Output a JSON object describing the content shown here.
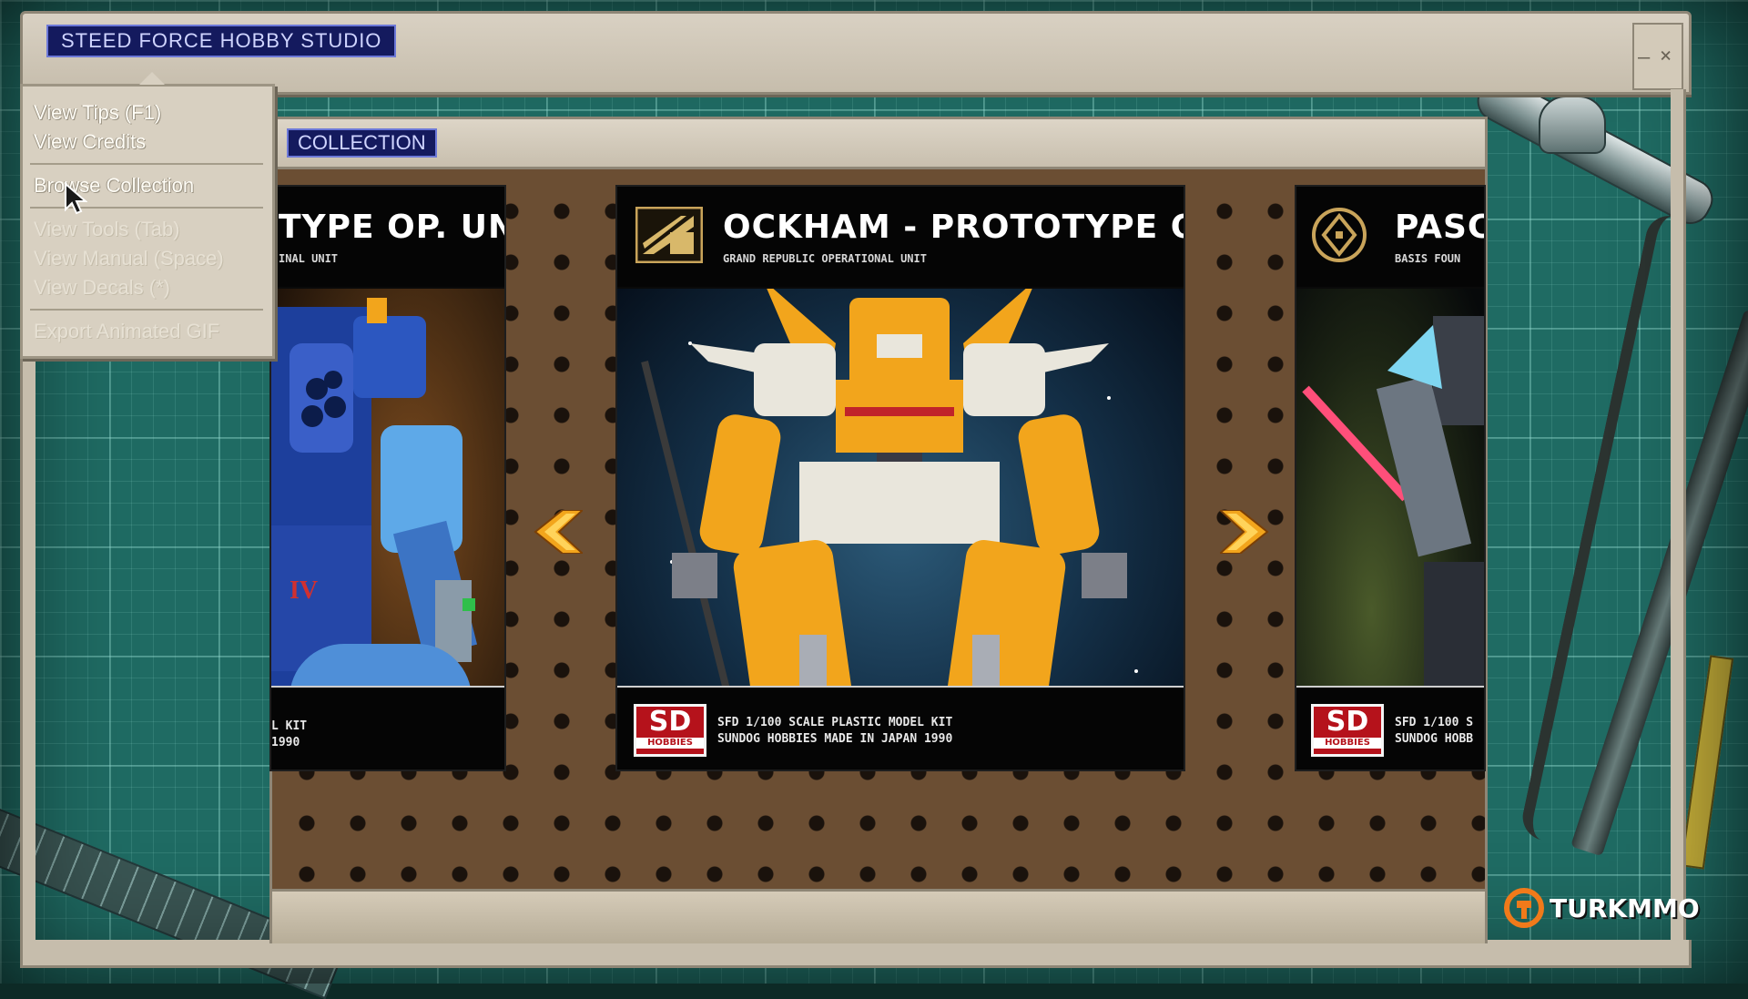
{
  "app": {
    "title": "STEED FORCE HOBBY STUDIO"
  },
  "window_controls": {
    "minimize": "–",
    "close": "×"
  },
  "menu": {
    "items": [
      {
        "label": "View Tips (F1)",
        "enabled": true
      },
      {
        "label": "View Credits",
        "enabled": true
      },
      {
        "label": "Browse Collection",
        "enabled": true
      },
      {
        "label": "View Tools (Tab)",
        "enabled": false
      },
      {
        "label": "View Manual (Space)",
        "enabled": false
      },
      {
        "label": "View Decals (*)",
        "enabled": false
      },
      {
        "label": "Export Animated GIF",
        "enabled": false
      }
    ]
  },
  "collection": {
    "label": "COLLECTION",
    "cards": {
      "left": {
        "title": "TYPE OP. UNIT",
        "subtitle": "INAL UNIT",
        "kit_line1": "L KIT",
        "kit_line2": "1990",
        "art_mark": "IV"
      },
      "center": {
        "title": "OCKHAM - PROTOTYPE OP. UNIT",
        "subtitle": "GRAND REPUBLIC OPERATIONAL UNIT",
        "kit_line1": "SFD 1/100 SCALE PLASTIC MODEL KIT",
        "kit_line2": "SUNDOG HOBBIES MADE IN JAPAN 1990"
      },
      "right": {
        "title": "PASCA",
        "subtitle": "BASIS FOUN",
        "kit_line1": "SFD 1/100 S",
        "kit_line2": "SUNDOG HOBB"
      }
    },
    "logo": {
      "big": "SD",
      "small": "HOBBIES"
    }
  },
  "watermark": {
    "text": "TURKMMO"
  },
  "colors": {
    "accent_orange": "#f2a51c",
    "badge_blue": "#141a5e",
    "sd_red": "#b5121b",
    "mat_teal": "#1f6b63"
  },
  "icons": {
    "left_arrow": "chevron-left-icon",
    "right_arrow": "chevron-right-icon",
    "cursor": "mouse-pointer-icon"
  }
}
